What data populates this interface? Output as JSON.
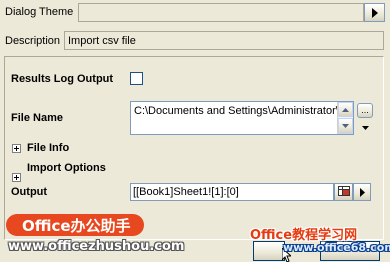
{
  "dialog_theme": {
    "label": "Dialog Theme",
    "value": ""
  },
  "description": {
    "label": "Description",
    "value": "Import csv file"
  },
  "results_log": {
    "label": "Results Log Output",
    "checked": false
  },
  "file_name": {
    "label": "File Name",
    "value": "C:\\Documents and Settings\\Administrator\\",
    "browse_label": "..."
  },
  "file_info": {
    "label": "File Info"
  },
  "import_options": {
    "label": "Import Options"
  },
  "output": {
    "label": "Output",
    "value": "[[Book1]Sheet1![1]:[0]"
  },
  "watermarks": {
    "left_brand": "Office办公助手",
    "left_url": "www.officezhushou.com",
    "right_brand": "Office教程学习网",
    "right_url": "www.office68.com"
  },
  "colors": {
    "background": "#ece9d8",
    "brand_orange": "#e63a10",
    "brand_blue": "#0a3c8c"
  },
  "icons": [
    "play-arrow-icon",
    "scroll-up-icon",
    "scroll-down-icon",
    "dropdown-arrow-icon",
    "range-select-icon",
    "expand-plus-icon"
  ]
}
